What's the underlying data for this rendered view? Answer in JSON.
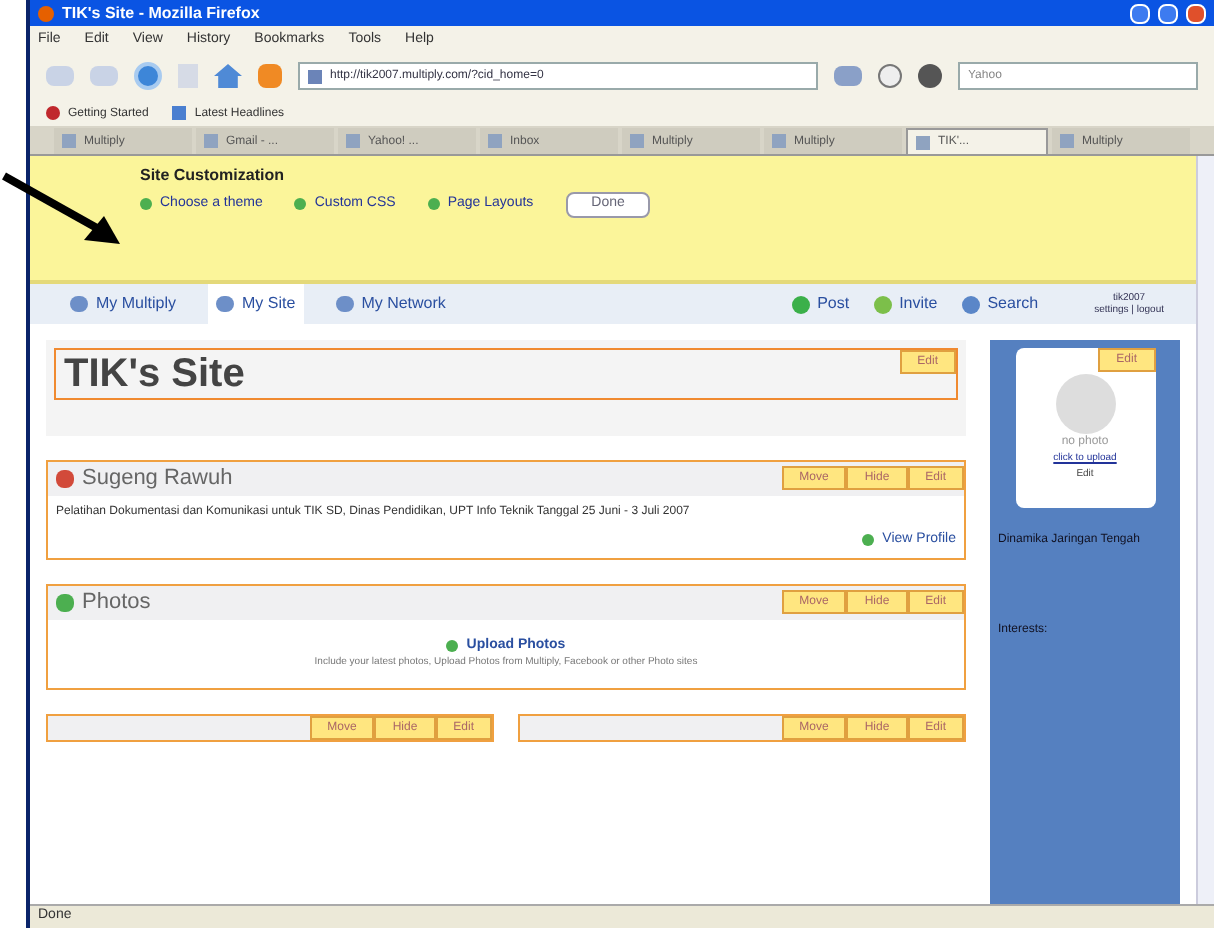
{
  "window": {
    "title": "TIK's Site - Mozilla Firefox"
  },
  "menu": [
    "File",
    "Edit",
    "View",
    "History",
    "Bookmarks",
    "Tools",
    "Help"
  ],
  "address": {
    "value": "http://tik2007.multiply.com/?cid_home=0"
  },
  "search": {
    "placeholder": "Yahoo"
  },
  "bookmarks": [
    "Getting Started",
    "Latest Headlines"
  ],
  "tabs": [
    {
      "label": "Multiply",
      "selected": false
    },
    {
      "label": "Gmail - ...",
      "selected": false
    },
    {
      "label": "Yahoo! ...",
      "selected": false
    },
    {
      "label": "Inbox",
      "selected": false
    },
    {
      "label": "Multiply",
      "selected": false
    },
    {
      "label": "Multiply",
      "selected": false
    },
    {
      "label": "TIK'...",
      "selected": true
    },
    {
      "label": "Multiply",
      "selected": false
    }
  ],
  "customization": {
    "title": "Site Customization",
    "links": [
      "Choose a theme",
      "Custom CSS",
      "Page Layouts"
    ],
    "done": "Done"
  },
  "nav": {
    "items": [
      {
        "label": "My Multiply",
        "selected": false
      },
      {
        "label": "My Site",
        "selected": true
      },
      {
        "label": "My Network",
        "selected": false
      }
    ],
    "actions": [
      "Post",
      "Invite",
      "Search"
    ],
    "account": [
      "tik2007",
      "settings | logout"
    ]
  },
  "site_title": {
    "text": "TIK's Site",
    "edit": "Edit"
  },
  "profile": {
    "name": "Sugeng Rawuh",
    "buttons": [
      "Move",
      "Hide",
      "Edit"
    ],
    "text": "Pelatihan Dokumentasi dan Komunikasi untuk TIK SD, Dinas Pendidikan, UPT Info Teknik Tanggal 25 Juni - 3 Juli 2007",
    "link": "View Profile"
  },
  "photos": {
    "title": "Photos",
    "buttons": [
      "Move",
      "Hide",
      "Edit"
    ],
    "link": "Upload Photos",
    "note": "Include your latest photos, Upload Photos from Multiply, Facebook or other Photo sites"
  },
  "bottom_boxes": [
    {
      "buttons": [
        "Move",
        "Hide",
        "Edit"
      ]
    },
    {
      "buttons": [
        "Move",
        "Hide",
        "Edit"
      ]
    }
  ],
  "sidebar": {
    "edit": "Edit",
    "photo_caption": "no photo",
    "photo_link": "click to upload",
    "name": "Edit",
    "info": "Dinamika Jaringan Tengah",
    "interests": "Interests:"
  },
  "status_bar": "Done"
}
